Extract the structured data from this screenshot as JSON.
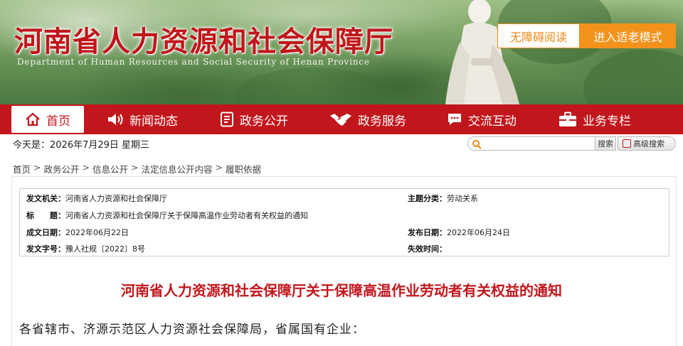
{
  "header": {
    "title": "河南省人力资源和社会保障厅",
    "subtitle": "Department of Human Resources and Social Security of Henan Province",
    "accessibility_button": "无障碍阅读",
    "elder_mode_button": "进入适老模式",
    "colors": {
      "brand_red": "#c1161c",
      "accent_orange": "#f3921b"
    }
  },
  "nav": {
    "items": [
      {
        "label": "首页",
        "icon": "home-icon",
        "active": true
      },
      {
        "label": "新闻动态",
        "icon": "speaker-icon"
      },
      {
        "label": "政务公开",
        "icon": "document-icon"
      },
      {
        "label": "政务服务",
        "icon": "handshake-icon"
      },
      {
        "label": "交流互动",
        "icon": "chat-icon"
      },
      {
        "label": "业务专栏",
        "icon": "briefcase-icon"
      }
    ]
  },
  "topbar": {
    "today": "今天是：2026年7月29日 星期三",
    "search_placeholder": "",
    "search_button": "搜索",
    "advanced_search": "高级搜索"
  },
  "breadcrumb": [
    "首页",
    "政务公开",
    "信息公开",
    "法定信息公开内容",
    "履职依据"
  ],
  "meta": {
    "issuer_label": "发文机关：",
    "issuer": "河南省人力资源和社会保障厅",
    "topic_label": "主题分类：",
    "topic": "劳动关系",
    "title_label": "标　　题：",
    "title": "河南省人力资源和社会保障厅关于保障高温作业劳动者有关权益的通知",
    "created_label": "成文日期：",
    "created": "2022年06月22日",
    "published_label": "发布日期：",
    "published": "2022年06月24日",
    "docno_label": "发文字号：",
    "docno": "豫人社规〔2022〕8号",
    "expiry_label": "失效时间：",
    "expiry": ""
  },
  "document": {
    "title": "河南省人力资源和社会保障厅关于保障高温作业劳动者有关权益的通知",
    "salutation": "各省辖市、济源示范区人力资源社会保障局，省属国有企业："
  }
}
